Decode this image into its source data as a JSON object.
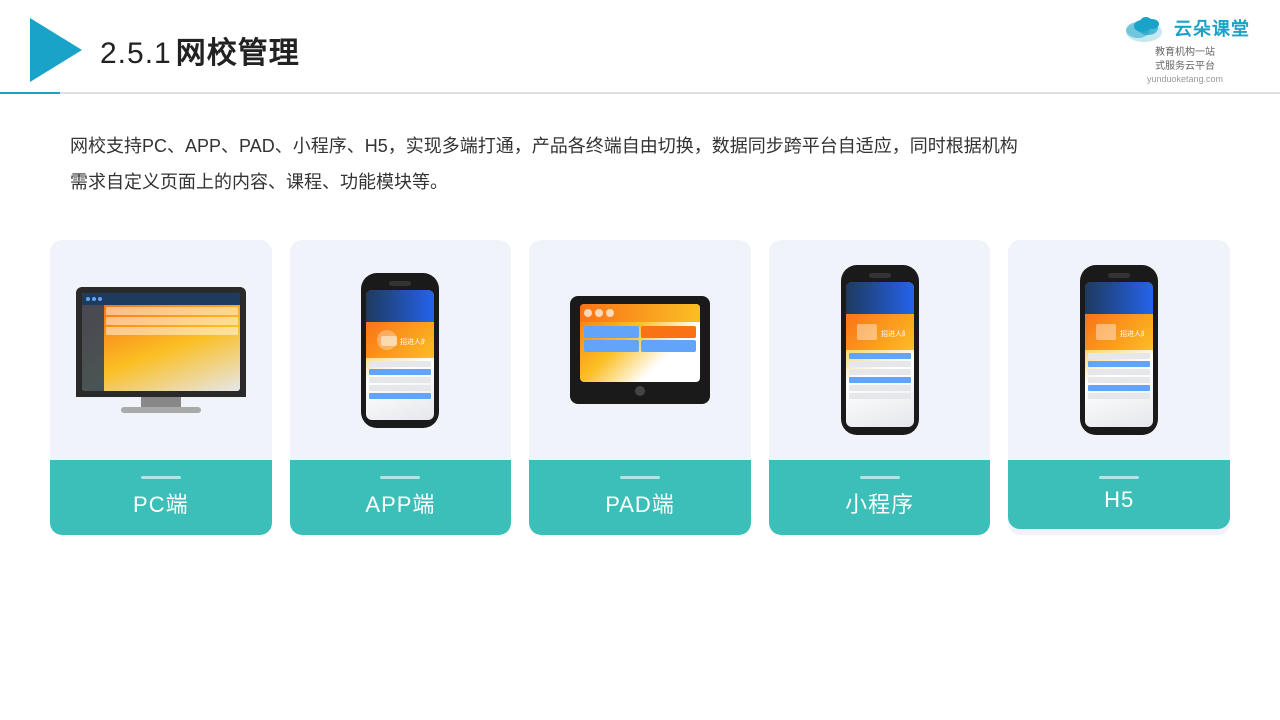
{
  "header": {
    "section_number": "2.5.1",
    "title": "网校管理",
    "brand_name": "云朵课堂",
    "brand_tagline_line1": "教育机构一站",
    "brand_tagline_line2": "式服务云平台",
    "brand_url": "yunduoketang.com"
  },
  "description": {
    "text": "网校支持PC、APP、PAD、小程序、H5，实现多端打通，产品各终端自由切换，数据同步跨平台自适应，同时根据机构需求自定义页面上的内容、课程、功能模块等。"
  },
  "cards": [
    {
      "id": "pc",
      "label": "PC端",
      "device": "pc"
    },
    {
      "id": "app",
      "label": "APP端",
      "device": "phone"
    },
    {
      "id": "pad",
      "label": "PAD端",
      "device": "tablet"
    },
    {
      "id": "miniprogram",
      "label": "小程序",
      "device": "phone-tall"
    },
    {
      "id": "h5",
      "label": "H5",
      "device": "phone-tall"
    }
  ]
}
